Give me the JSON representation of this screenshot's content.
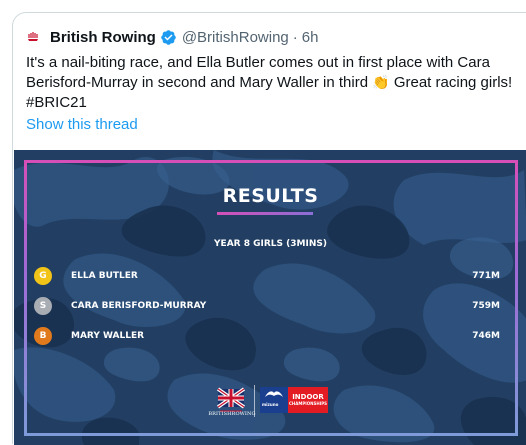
{
  "tweet": {
    "author_name": "British Rowing",
    "handle": "@BritishRowing",
    "separator": "·",
    "time": "6h",
    "text_part1": "It's a nail-biting race, and Ella Butler comes out in first place with Cara Berisford-Murray in second and Mary Waller in third ",
    "emoji": "👏",
    "text_part2": " Great racing girls! #BRIC21",
    "show_thread": "Show this thread"
  },
  "card": {
    "title": "RESULTS",
    "category": "YEAR 8 GIRLS (3MINS)",
    "results": [
      {
        "medal": "G",
        "name": "ELLA BUTLER",
        "distance": "771M",
        "color": "#f2c418"
      },
      {
        "medal": "S",
        "name": "CARA BERISFORD-MURRAY",
        "distance": "759M",
        "color": "#a8adb3"
      },
      {
        "medal": "B",
        "name": "MARY WALLER",
        "distance": "746M",
        "color": "#e07a1c"
      }
    ],
    "footer": {
      "british_rowing": "BRITISHROWING",
      "sponsor": "mizuno",
      "indoor": "INDOOR",
      "championships": "CHAMPIONSHIPS"
    }
  },
  "colors": {
    "link": "#1d9bf0",
    "verified": "#1d9bf0",
    "card_bg": "#1f3a5c"
  }
}
